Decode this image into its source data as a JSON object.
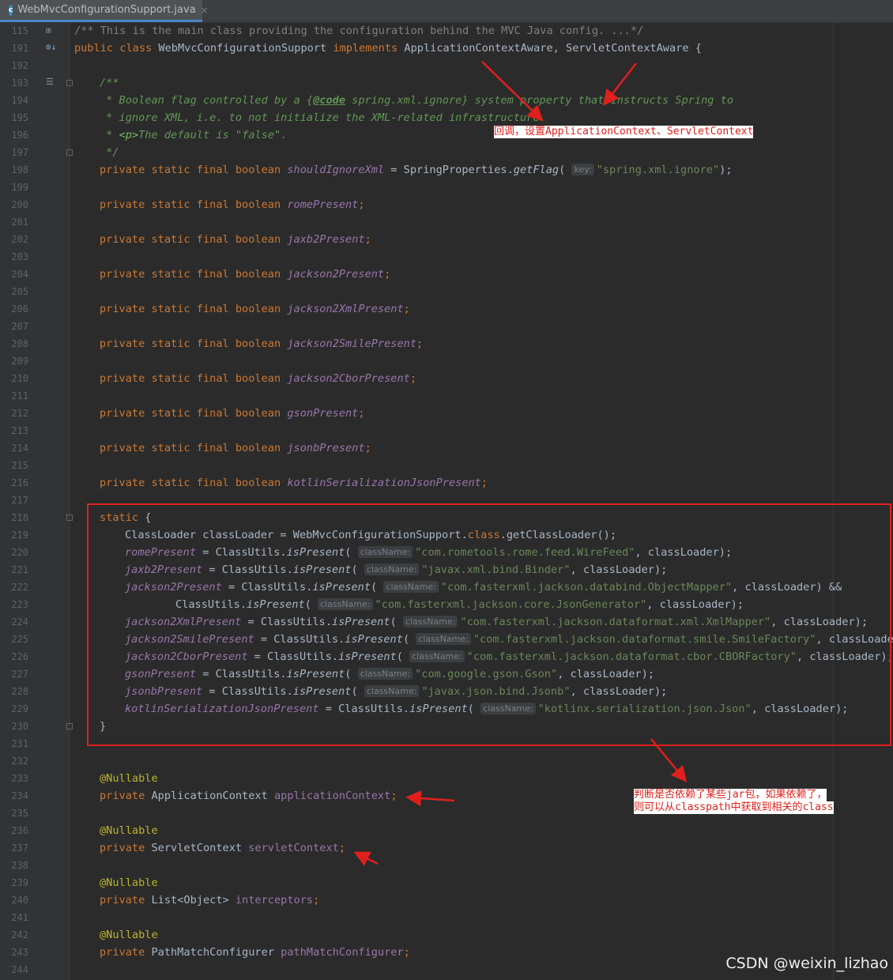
{
  "tab": {
    "filename": "WebMvcConfigurationSupport.java",
    "close": "×",
    "icon": "java-class-icon"
  },
  "lines": [
    {
      "n": "115",
      "text": "/** This is the main class providing the configuration behind the MVC Java config. ...*/"
    },
    {
      "n": "191",
      "text": "public class WebMvcConfigurationSupport implements ApplicationContextAware, ServletContextAware {"
    },
    {
      "n": "192",
      "text": ""
    },
    {
      "n": "193",
      "text": "/**"
    },
    {
      "n": "194",
      "text": " * Boolean flag controlled by a {@code spring.xml.ignore} system property that instructs Spring to"
    },
    {
      "n": "195",
      "text": " * ignore XML, i.e. to not initialize the XML-related infrastructure."
    },
    {
      "n": "196",
      "text": " * <p>The default is \"false\"."
    },
    {
      "n": "197",
      "text": " */"
    },
    {
      "n": "198",
      "text": "private static final boolean shouldIgnoreXml = SpringProperties.getFlag( key: \"spring.xml.ignore\");"
    },
    {
      "n": "199",
      "text": ""
    },
    {
      "n": "200",
      "text": "private static final boolean romePresent;"
    },
    {
      "n": "201",
      "text": ""
    },
    {
      "n": "202",
      "text": "private static final boolean jaxb2Present;"
    },
    {
      "n": "203",
      "text": ""
    },
    {
      "n": "204",
      "text": "private static final boolean jackson2Present;"
    },
    {
      "n": "205",
      "text": ""
    },
    {
      "n": "206",
      "text": "private static final boolean jackson2XmlPresent;"
    },
    {
      "n": "207",
      "text": ""
    },
    {
      "n": "208",
      "text": "private static final boolean jackson2SmilePresent;"
    },
    {
      "n": "209",
      "text": ""
    },
    {
      "n": "210",
      "text": "private static final boolean jackson2CborPresent;"
    },
    {
      "n": "211",
      "text": ""
    },
    {
      "n": "212",
      "text": "private static final boolean gsonPresent;"
    },
    {
      "n": "213",
      "text": ""
    },
    {
      "n": "214",
      "text": "private static final boolean jsonbPresent;"
    },
    {
      "n": "215",
      "text": ""
    },
    {
      "n": "216",
      "text": "private static final boolean kotlinSerializationJsonPresent;"
    },
    {
      "n": "217",
      "text": ""
    },
    {
      "n": "218",
      "text": "static {"
    },
    {
      "n": "219",
      "text": "ClassLoader classLoader = WebMvcConfigurationSupport.class.getClassLoader();"
    },
    {
      "n": "220",
      "text": "romePresent = ClassUtils.isPresent( className: \"com.rometools.rome.feed.WireFeed\", classLoader);"
    },
    {
      "n": "221",
      "text": "jaxb2Present = ClassUtils.isPresent( className: \"javax.xml.bind.Binder\", classLoader);"
    },
    {
      "n": "222",
      "text": "jackson2Present = ClassUtils.isPresent( className: \"com.fasterxml.jackson.databind.ObjectMapper\", classLoader) &&"
    },
    {
      "n": "223",
      "text": "ClassUtils.isPresent( className: \"com.fasterxml.jackson.core.JsonGenerator\", classLoader);"
    },
    {
      "n": "224",
      "text": "jackson2XmlPresent = ClassUtils.isPresent( className: \"com.fasterxml.jackson.dataformat.xml.XmlMapper\", classLoader);"
    },
    {
      "n": "225",
      "text": "jackson2SmilePresent = ClassUtils.isPresent( className: \"com.fasterxml.jackson.dataformat.smile.SmileFactory\", classLoader);"
    },
    {
      "n": "226",
      "text": "jackson2CborPresent = ClassUtils.isPresent( className: \"com.fasterxml.jackson.dataformat.cbor.CBORFactory\", classLoader);"
    },
    {
      "n": "227",
      "text": "gsonPresent = ClassUtils.isPresent( className: \"com.google.gson.Gson\", classLoader);"
    },
    {
      "n": "228",
      "text": "jsonbPresent = ClassUtils.isPresent( className: \"javax.json.bind.Jsonb\", classLoader);"
    },
    {
      "n": "229",
      "text": "kotlinSerializationJsonPresent = ClassUtils.isPresent( className: \"kotlinx.serialization.json.Json\", classLoader);"
    },
    {
      "n": "230",
      "text": "}"
    },
    {
      "n": "231",
      "text": ""
    },
    {
      "n": "232",
      "text": ""
    },
    {
      "n": "233",
      "text": "@Nullable"
    },
    {
      "n": "234",
      "text": "private ApplicationContext applicationContext;"
    },
    {
      "n": "235",
      "text": ""
    },
    {
      "n": "236",
      "text": "@Nullable"
    },
    {
      "n": "237",
      "text": "private ServletContext servletContext;"
    },
    {
      "n": "238",
      "text": ""
    },
    {
      "n": "239",
      "text": "@Nullable"
    },
    {
      "n": "240",
      "text": "private List<Object> interceptors;"
    },
    {
      "n": "241",
      "text": ""
    },
    {
      "n": "242",
      "text": "@Nullable"
    },
    {
      "n": "243",
      "text": "private PathMatchConfigurer pathMatchConfigurer;"
    },
    {
      "n": "244",
      "text": ""
    }
  ],
  "annotations": {
    "callback_note": "回调，设置ApplicationContext、ServletContext",
    "jar_note_line1": "判断是否依赖了某些jar包，如果依赖了，",
    "jar_note_line2": "则可以从classpath中获取到相关的class"
  },
  "watermark": "CSDN @weixin_lizhao",
  "colors": {
    "keyword": "#cc7832",
    "field": "#9876aa",
    "string": "#6a8759",
    "comment": "#629755",
    "annotation": "#bbb529",
    "method": "#ffc66d",
    "highlight": "#e0201c"
  }
}
